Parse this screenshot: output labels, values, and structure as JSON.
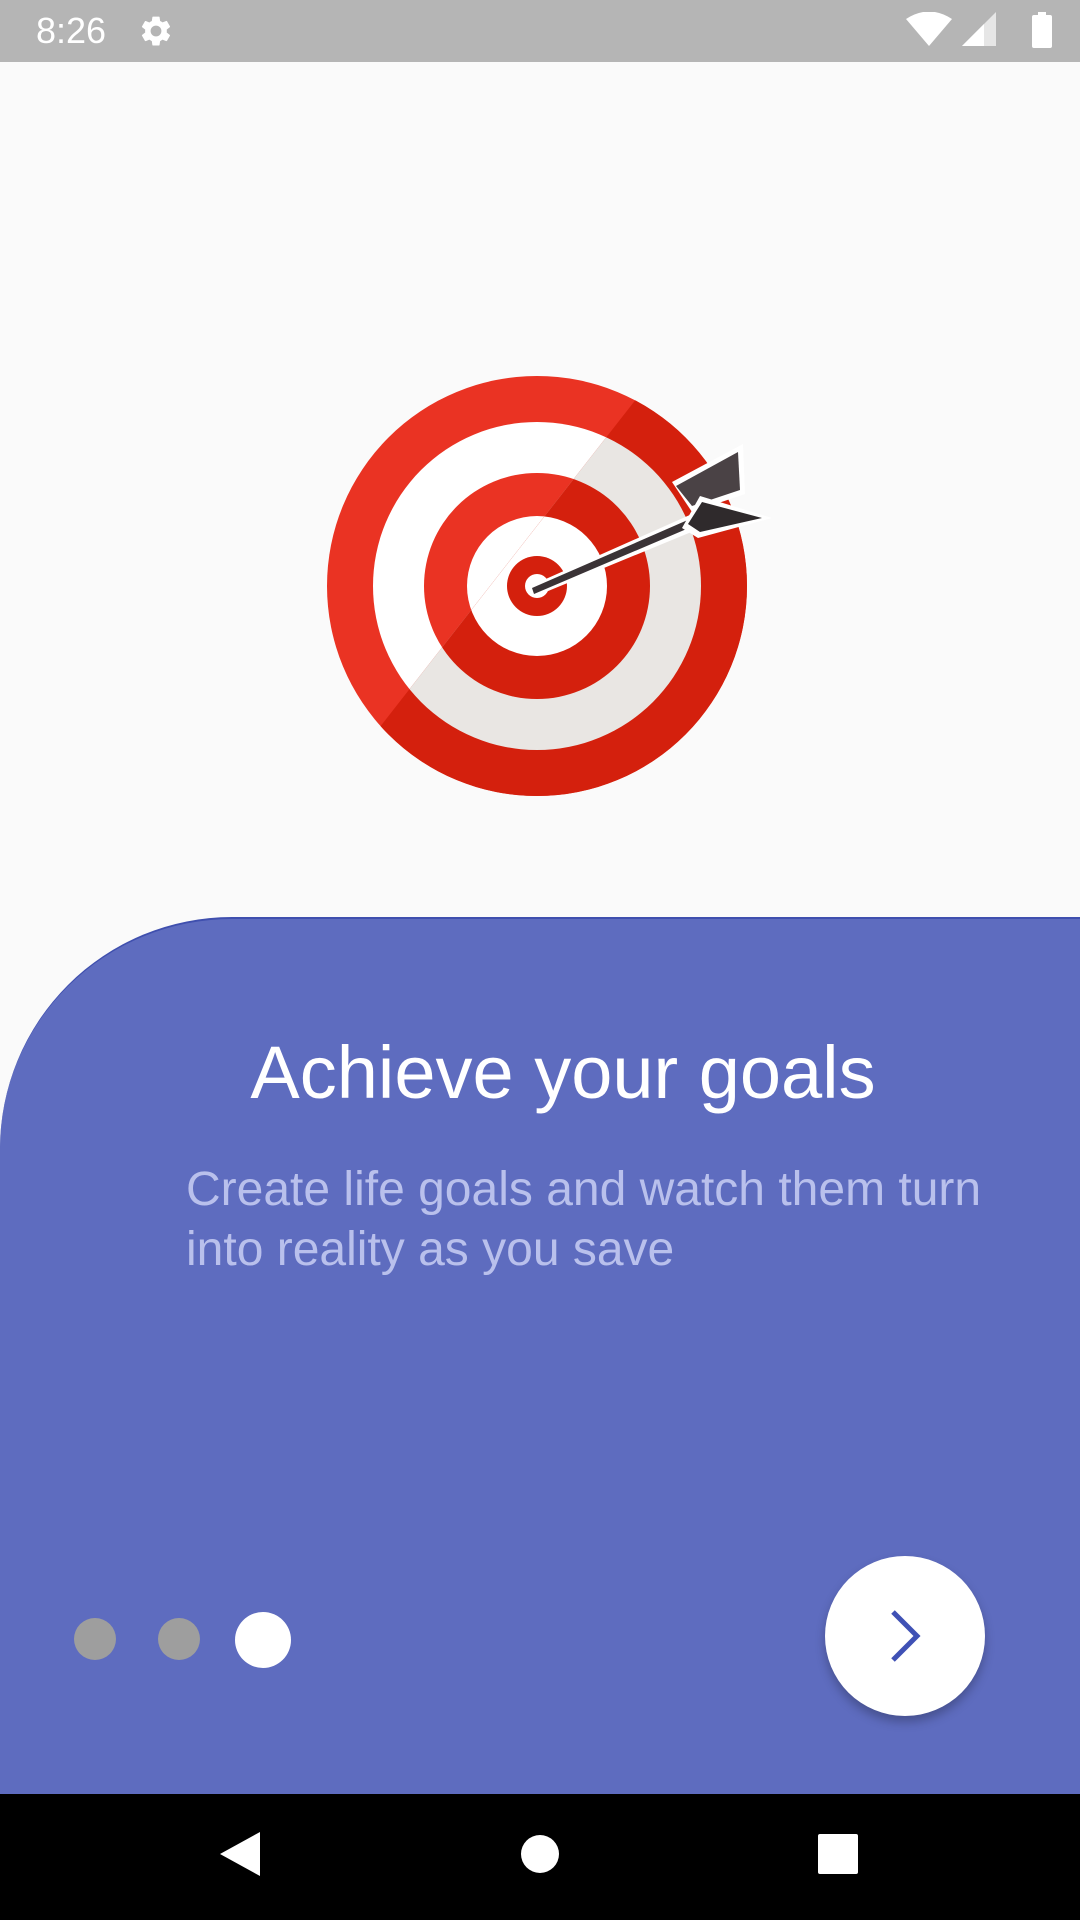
{
  "status_bar": {
    "time": "8:26",
    "icons": [
      "settings-gear-icon",
      "wifi-icon",
      "cell-signal-icon",
      "battery-icon"
    ],
    "background": "#b5b5b5"
  },
  "hero_image": {
    "icon": "target-with-dart-icon"
  },
  "onboarding": {
    "title": "Achieve your goals",
    "description": "Create life goals and watch them turn into reality as you save",
    "page_total": 3,
    "current_page": 3,
    "next_icon": "chevron-right-icon",
    "colors": {
      "panel": "#5e6cbf",
      "description": "#b9c0ec",
      "dot_inactive": "#9e9e9e",
      "dot_active": "#ffffff",
      "chevron": "#3f51b5"
    }
  },
  "nav_bar": {
    "buttons": [
      "back-triangle-icon",
      "home-circle-icon",
      "recents-square-icon"
    ]
  }
}
